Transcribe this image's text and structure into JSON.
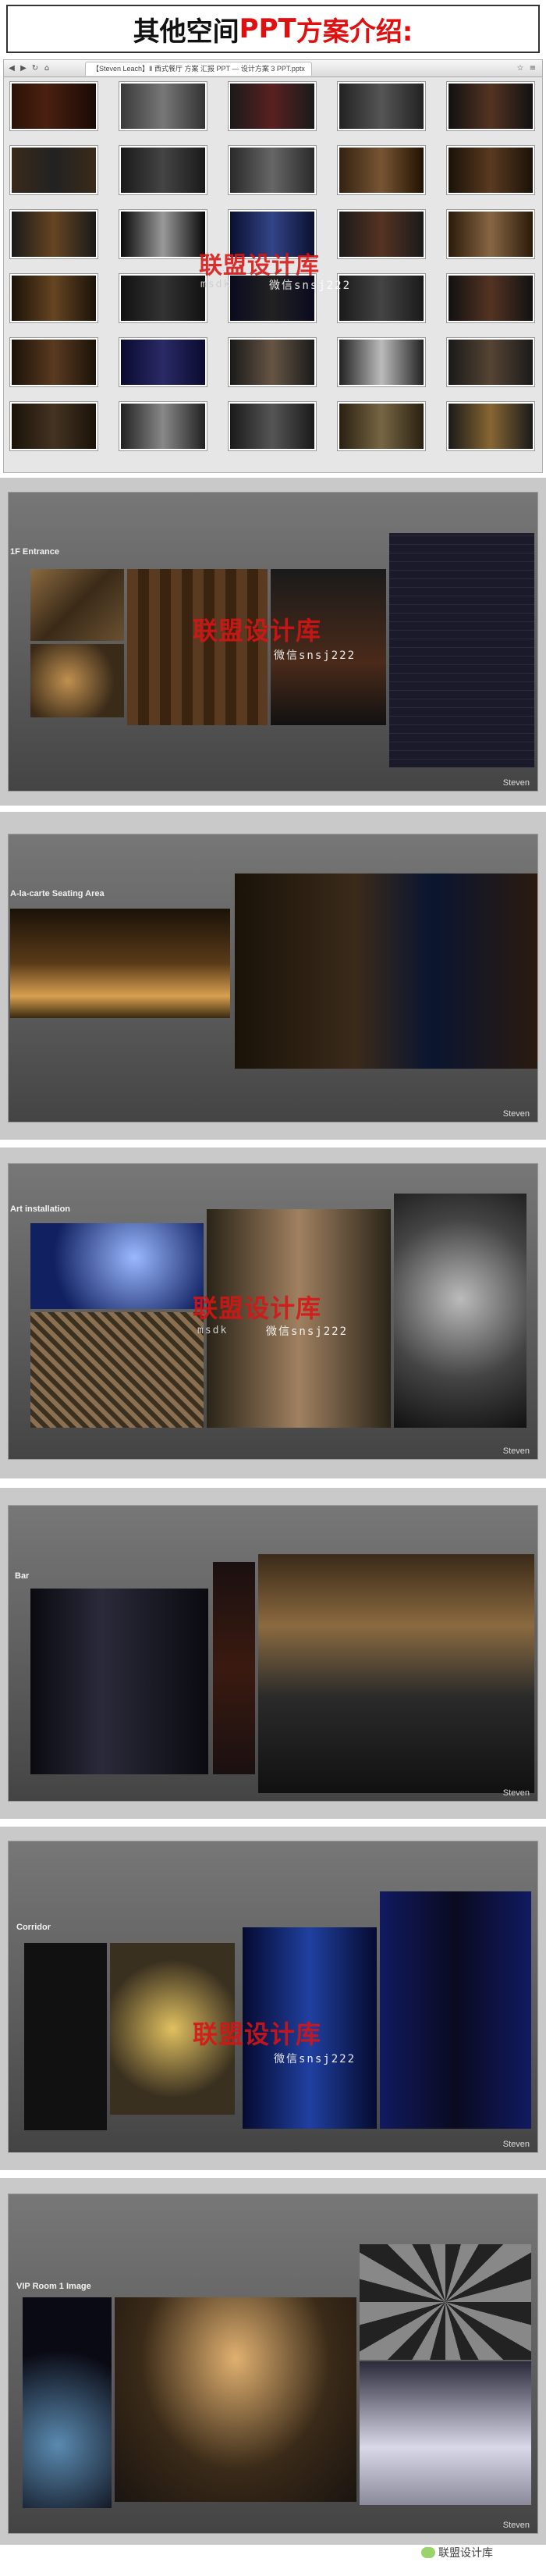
{
  "banner": {
    "title_part1": "其他空间",
    "title_part2": "PPT",
    "title_part3": "方案介绍:"
  },
  "app": {
    "tab_label": "【Steven Leach】Ⅱ 西式餐厅 方案 汇报 PPT — 设计方案 3 PPT.pptx",
    "icons": [
      "back-icon",
      "forward-icon",
      "refresh-icon",
      "home-icon",
      "star-icon"
    ]
  },
  "watermark": {
    "brand": "联盟设计库",
    "sub_left": "msdk",
    "sub_right": "微信snsj222"
  },
  "slides": [
    {
      "title": "1F Entrance",
      "footer": "Steven"
    },
    {
      "title": "A-la-carte Seating Area",
      "footer": "Steven"
    },
    {
      "title": "Art installation",
      "footer": "Steven"
    },
    {
      "title": "Bar",
      "footer": "Steven"
    },
    {
      "title": "Corridor",
      "footer": "Steven"
    },
    {
      "title": "VIP Room 1 Image",
      "footer": "Steven"
    }
  ],
  "footer": {
    "label": "联盟设计库"
  },
  "colors": {
    "accent_red": "#e01010",
    "slide_bg": "#5a5a5a"
  }
}
